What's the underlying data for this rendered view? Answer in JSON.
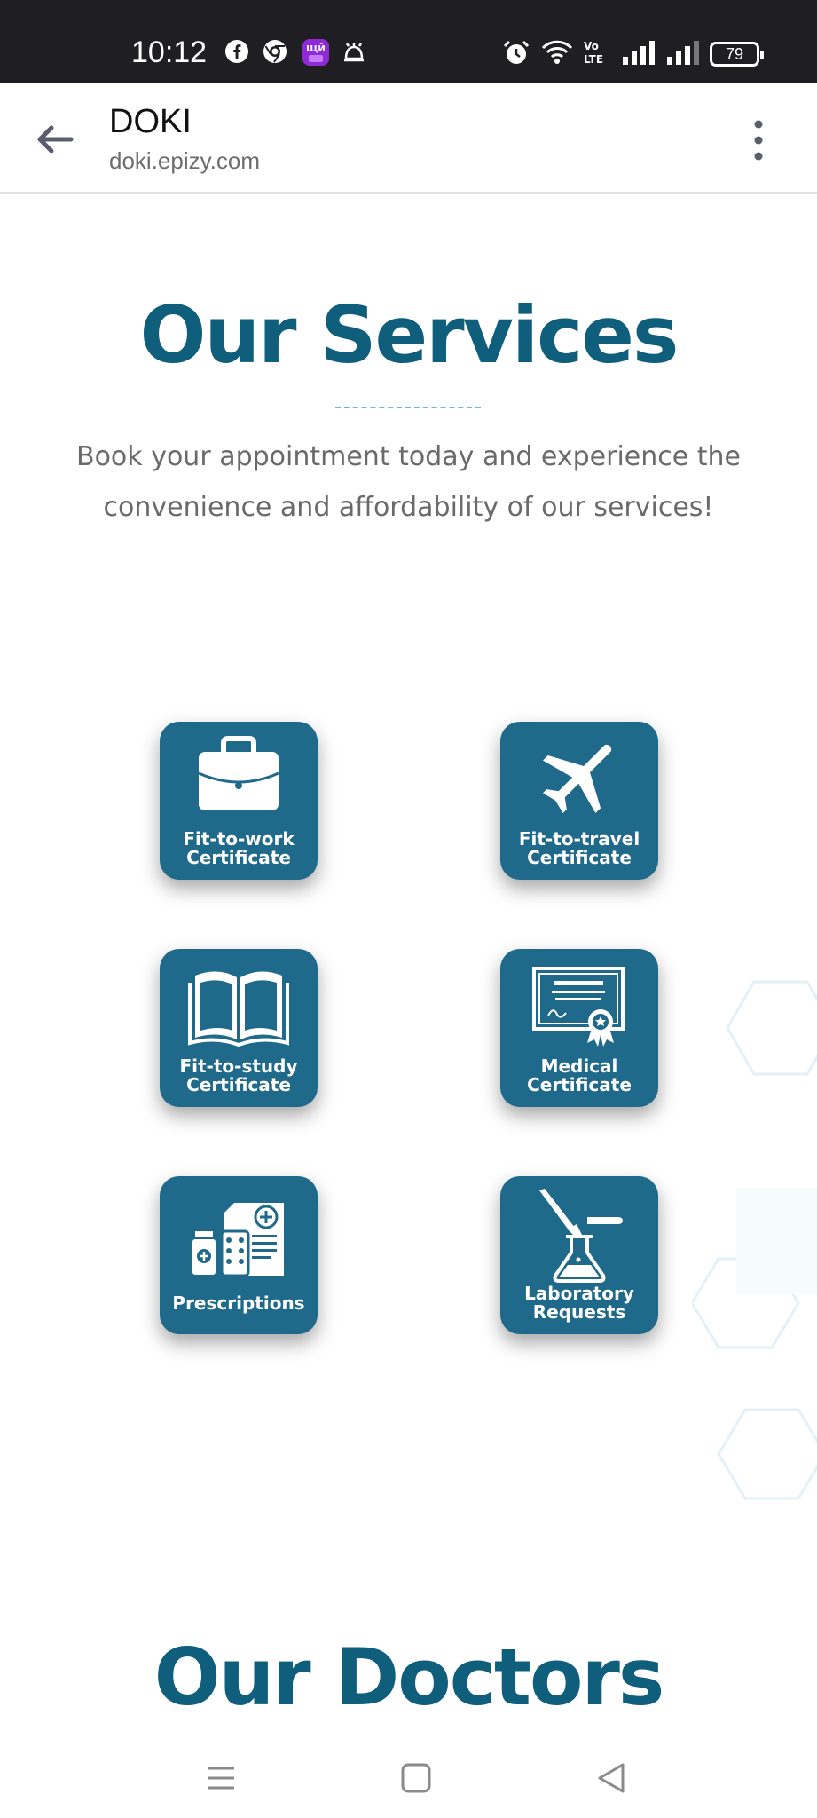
{
  "status_bar": {
    "time": "10:12",
    "battery": "79",
    "left_icons": [
      "facebook-icon",
      "chrome-icon",
      "app-badge-icon",
      "bell-icon"
    ],
    "right_icons": [
      "alarm-icon",
      "wifi-icon",
      "volte-icon",
      "signal-icon",
      "signal-icon"
    ]
  },
  "app_bar": {
    "title": "DOKI",
    "url": "doki.epizy.com"
  },
  "services": {
    "title": "Our Services",
    "description": "Book your appointment today and experience the convenience and affordability of our services!",
    "cards": [
      {
        "icon": "briefcase-icon",
        "line1": "Fit-to-work",
        "line2": "Certificate"
      },
      {
        "icon": "airplane-icon",
        "line1": "Fit-to-travel",
        "line2": "Certificate"
      },
      {
        "icon": "book-icon",
        "line1": "Fit-to-study",
        "line2": "Certificate"
      },
      {
        "icon": "certificate-icon",
        "line1": "Medical",
        "line2": "Certificate"
      },
      {
        "icon": "prescription-icon",
        "line1": "Prescriptions",
        "line2": ""
      },
      {
        "icon": "lab-flask-icon",
        "line1": "Laboratory",
        "line2": "Requests"
      }
    ]
  },
  "doctors": {
    "title": "Our Doctors"
  },
  "colors": {
    "brand": "#0f5f7c",
    "card": "#1f6a8a",
    "status_bar": "#1f1e23",
    "text_muted": "#6a6a6a",
    "divider": "#6cb6dd"
  }
}
